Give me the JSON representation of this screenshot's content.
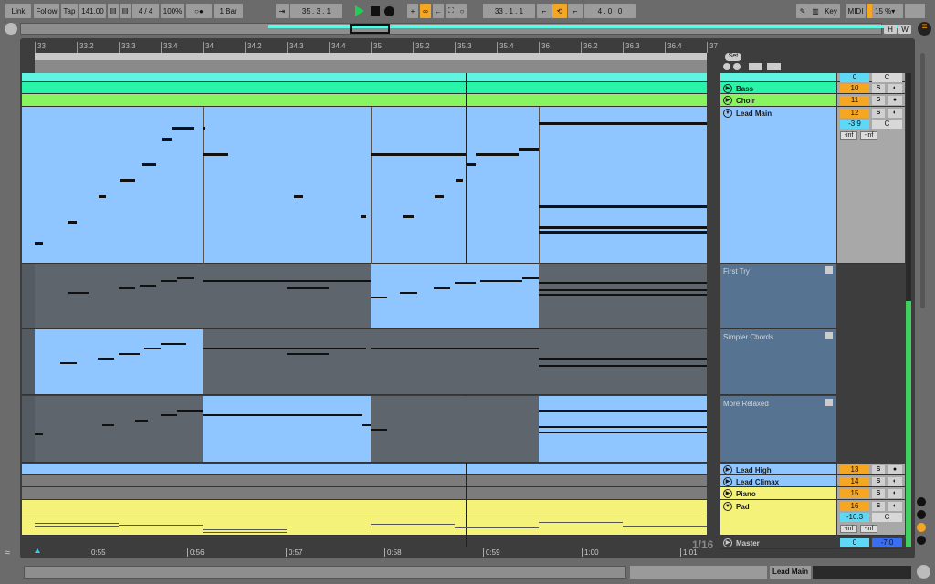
{
  "toolbar": {
    "link": "Link",
    "follow": "Follow",
    "tap": "Tap",
    "tempo": "141.00",
    "time_sig": "4 / 4",
    "zoom": "100%",
    "metronome": "○●",
    "quantize": "1 Bar",
    "position": "35 .  3 .  1",
    "loop_start": "33 .  1 .  1",
    "loop_length": "4 .  0 .  0",
    "key": "Key",
    "midi": "MIDI",
    "cpu": "15 %",
    "cpu_level_percent": 15,
    "accent": "#f5a623"
  },
  "overview": {
    "h": "H",
    "w": "W"
  },
  "ruler": {
    "ticks": [
      "33",
      "33.2",
      "33.3",
      "33.4",
      "34",
      "34.2",
      "34.3",
      "34.4",
      "35",
      "35.2",
      "35.3",
      "35.4",
      "36",
      "36.2",
      "36.3",
      "36.4",
      "37"
    ]
  },
  "set": {
    "label": "Set"
  },
  "time_ruler": {
    "labels": [
      "0:55",
      "0:56",
      "0:57",
      "0:58",
      "0:59",
      "1:00",
      "1:01"
    ],
    "grid": "1/16"
  },
  "tracks": {
    "top": {
      "number": "0",
      "pan": "C",
      "color": "#5ff5e0"
    },
    "bass": {
      "name": "Bass",
      "number": "10",
      "solo": "S",
      "color": "#28f5a8"
    },
    "choir": {
      "name": "Choir",
      "number": "11",
      "solo": "S",
      "color": "#88f560"
    },
    "lead_main": {
      "name": "Lead Main",
      "number": "12",
      "solo": "S",
      "volume": "-3.9",
      "pan": "C",
      "send_a": "-inf",
      "send_b": "-inf",
      "color": "#8fc6ff",
      "notes": [
        [
          0,
          0.2,
          60
        ],
        [
          0.78,
          1,
          64
        ],
        [
          1.52,
          1.7,
          69
        ],
        [
          2.02,
          2.4,
          72
        ],
        [
          2.54,
          2.9,
          75
        ],
        [
          3.02,
          3.26,
          80
        ],
        [
          3.26,
          3.8,
          82
        ],
        [
          4,
          4.6,
          77
        ],
        [
          4,
          4.05,
          82
        ],
        [
          6.18,
          6.4,
          69
        ],
        [
          7.76,
          7.9,
          65
        ],
        [
          8,
          10.26,
          77
        ],
        [
          8.76,
          9.02,
          65
        ],
        [
          9.52,
          9.74,
          69
        ],
        [
          10.02,
          10.2,
          72
        ],
        [
          10.28,
          10.5,
          75
        ],
        [
          10.5,
          11.52,
          77
        ],
        [
          11.52,
          12,
          78
        ],
        [
          12,
          16,
          83
        ],
        [
          12,
          16,
          67
        ],
        [
          12,
          16,
          63
        ],
        [
          12,
          16,
          62
        ]
      ]
    },
    "takes": [
      {
        "name": "First Try",
        "blue": [
          false,
          false,
          true,
          false
        ],
        "notes": [
          [
            0.8,
            1.3,
            62
          ],
          [
            2,
            2.4,
            64
          ],
          [
            2.5,
            2.9,
            65
          ],
          [
            3,
            3.4,
            67
          ],
          [
            3.4,
            3.8,
            68
          ],
          [
            4,
            8,
            67
          ],
          [
            6,
            7,
            64
          ],
          [
            8,
            8.4,
            60
          ],
          [
            8.7,
            9.1,
            62
          ],
          [
            9.5,
            9.9,
            64
          ],
          [
            10,
            10.5,
            66
          ],
          [
            10.6,
            11.6,
            67
          ],
          [
            11.6,
            12,
            68
          ],
          [
            12,
            16,
            66
          ],
          [
            12,
            16,
            63
          ],
          [
            12,
            16,
            61
          ]
        ]
      },
      {
        "name": "Simpler Chords",
        "blue": [
          true,
          false,
          false,
          false
        ],
        "notes": [
          [
            0.6,
            1,
            58
          ],
          [
            1.5,
            1.9,
            60
          ],
          [
            2,
            2.5,
            62
          ],
          [
            2.6,
            3,
            64
          ],
          [
            3,
            3.6,
            66
          ],
          [
            4,
            7.9,
            64
          ],
          [
            6,
            7,
            62
          ],
          [
            8,
            12,
            64
          ],
          [
            12,
            16,
            60
          ],
          [
            12,
            16,
            57
          ]
        ]
      },
      {
        "name": "More Relaxed",
        "blue": [
          false,
          true,
          false,
          true
        ],
        "notes": [
          [
            0,
            0.2,
            50
          ],
          [
            1.6,
            1.9,
            54
          ],
          [
            2.4,
            2.7,
            56
          ],
          [
            3,
            3.4,
            58
          ],
          [
            3.4,
            4,
            60
          ],
          [
            4,
            7.8,
            58
          ],
          [
            7.8,
            8,
            54
          ],
          [
            8,
            8.4,
            52
          ],
          [
            12,
            16,
            60
          ],
          [
            12,
            16,
            53
          ],
          [
            12,
            16,
            51
          ]
        ]
      }
    ],
    "lead_high": {
      "name": "Lead High",
      "number": "13",
      "solo": "S",
      "color": "#8fc6ff"
    },
    "lead_climax": {
      "name": "Lead Climax",
      "number": "14",
      "solo": "S",
      "color": "#8fc6ff"
    },
    "piano": {
      "name": "Piano",
      "number": "15",
      "solo": "S",
      "color": "#f5f27a"
    },
    "pad": {
      "name": "Pad",
      "number": "16",
      "solo": "S",
      "volume": "-10.3",
      "pan": "C",
      "send_a": "-inf",
      "send_b": "-inf",
      "color": "#f5f27a"
    },
    "master": {
      "name": "Master",
      "number": "0",
      "volume": "-7.0"
    }
  },
  "status": {
    "selected_track": "Lead Main"
  }
}
